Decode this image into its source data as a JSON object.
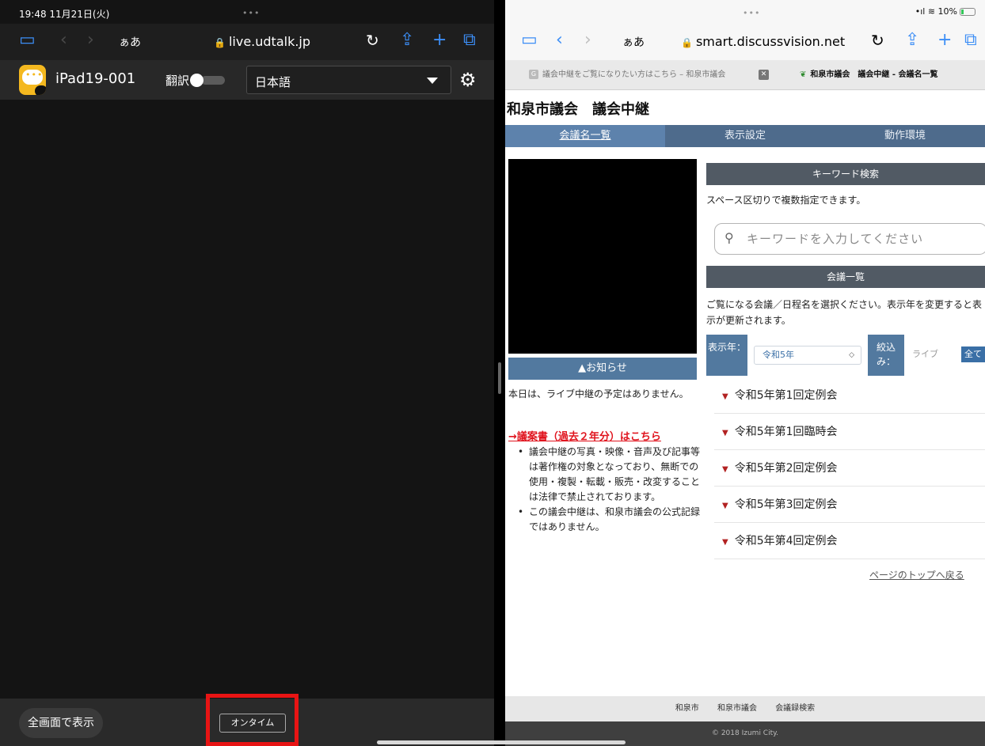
{
  "left": {
    "status": {
      "time": "19:48  11月21日(火)",
      "dots": "•••"
    },
    "safari": {
      "aa": "ぁあ",
      "url": "live.udtalk.jp"
    },
    "toolbar": {
      "device_name": "iPad19-001",
      "translate_label": "翻訳",
      "language": "日本語"
    },
    "bottom": {
      "fullscreen_label": "全画面で表示",
      "ontime_label": "オンタイム"
    },
    "highlight_color": "#e81414"
  },
  "right": {
    "status": {
      "dots": "•••",
      "signal": "•ıl ≋ 10%"
    },
    "safari": {
      "aa": "ぁあ",
      "url": "smart.discussvision.net"
    },
    "tabs": [
      {
        "label": "議会中継をご覧になりたい方はこちら – 和泉市議会",
        "favicon": "G"
      },
      {
        "label": "和泉市議会　議会中継 - 会議名一覧"
      }
    ],
    "site": {
      "title": "和泉市議会　議会中継",
      "nav": [
        "会議名一覧",
        "表示設定",
        "動作環境"
      ],
      "notice_header": "▲お知らせ",
      "notice_text": "本日は、ライブ中継の予定はありません。",
      "bill_link": "→議案書（過去２年分）はこちら",
      "notes": [
        "議会中継の写真・映像・音声及び記事等は著作権の対象となっており、無断での使用・複製・転載・販売・改変することは法律で禁止されております。",
        "この議会中継は、和泉市議会の公式記録ではありません。"
      ],
      "keyword_header": "キーワード検索",
      "keyword_help": "スペース区切りで複数指定できます。",
      "search_placeholder": "キーワードを入力してください",
      "meetings_header": "会議一覧",
      "meetings_help": "ご覧になる会議／日程名を選択ください。表示年を変更すると表示が更新されます。",
      "year_label": "表示年：",
      "year_value": "令和5年",
      "filter_label": "絞込み：",
      "filter_live": "ライブ",
      "filter_all": "全て",
      "meetings": [
        "令和5年第1回定例会",
        "令和5年第1回臨時会",
        "令和5年第2回定例会",
        "令和5年第3回定例会",
        "令和5年第4回定例会"
      ],
      "page_top": "ページのトップへ戻る",
      "footer_links": [
        "和泉市",
        "和泉市議会",
        "会議録検索"
      ],
      "copyright": "© 2018 Izumi City."
    }
  }
}
